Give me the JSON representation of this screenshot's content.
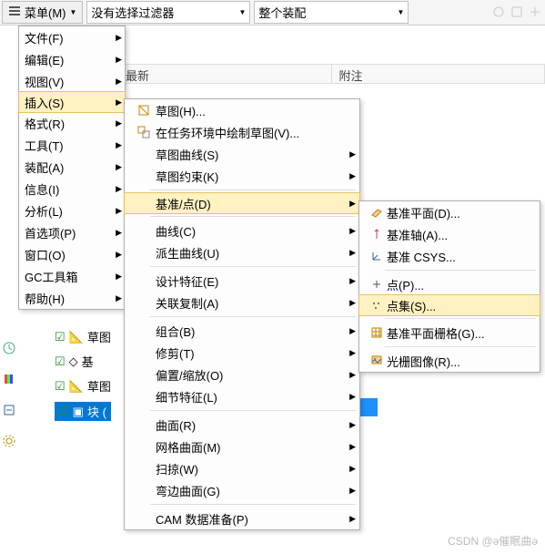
{
  "toolbar": {
    "menu_label": "菜单(M)",
    "filter_value": "没有选择过滤器",
    "assembly_value": "整个装配"
  },
  "headers": {
    "latest": "最新",
    "notes": "附注"
  },
  "menu1": {
    "items": [
      {
        "label": "文件(F)"
      },
      {
        "label": "编辑(E)"
      },
      {
        "label": "视图(V)"
      },
      {
        "label": "插入(S)",
        "hl": true
      },
      {
        "label": "格式(R)"
      },
      {
        "label": "工具(T)"
      },
      {
        "label": "装配(A)"
      },
      {
        "label": "信息(I)"
      },
      {
        "label": "分析(L)"
      },
      {
        "label": "首选项(P)"
      },
      {
        "label": "窗口(O)"
      },
      {
        "label": "GC工具箱"
      },
      {
        "label": "帮助(H)"
      }
    ]
  },
  "menu2": {
    "groups": [
      [
        {
          "label": "草图(H)...",
          "icon": "sketch"
        },
        {
          "label": "在任务环境中绘制草图(V)...",
          "icon": "sketch-task"
        },
        {
          "label": "草图曲线(S)",
          "sub": true
        },
        {
          "label": "草图约束(K)",
          "sub": true
        }
      ],
      [
        {
          "label": "基准/点(D)",
          "sub": true,
          "hl": true
        }
      ],
      [
        {
          "label": "曲线(C)",
          "sub": true
        },
        {
          "label": "派生曲线(U)",
          "sub": true
        }
      ],
      [
        {
          "label": "设计特征(E)",
          "sub": true
        },
        {
          "label": "关联复制(A)",
          "sub": true
        }
      ],
      [
        {
          "label": "组合(B)",
          "sub": true
        },
        {
          "label": "修剪(T)",
          "sub": true
        },
        {
          "label": "偏置/缩放(O)",
          "sub": true
        },
        {
          "label": "细节特征(L)",
          "sub": true
        }
      ],
      [
        {
          "label": "曲面(R)",
          "sub": true
        },
        {
          "label": "网格曲面(M)",
          "sub": true
        },
        {
          "label": "扫掠(W)",
          "sub": true
        },
        {
          "label": "弯边曲面(G)",
          "sub": true
        }
      ],
      [
        {
          "label": "CAM 数据准备(P)",
          "sub": true
        }
      ]
    ]
  },
  "menu3": {
    "items": [
      {
        "label": "基准平面(D)...",
        "icon": "plane"
      },
      {
        "label": "基准轴(A)...",
        "icon": "axis"
      },
      {
        "label": "基准 CSYS...",
        "icon": "csys"
      },
      {
        "sep": true
      },
      {
        "label": "点(P)...",
        "icon": "point"
      },
      {
        "label": "点集(S)...",
        "icon": "pointset",
        "hl": true
      },
      {
        "sep": true
      },
      {
        "label": "基准平面栅格(G)...",
        "icon": "grid"
      },
      {
        "sep": true
      },
      {
        "label": "光栅图像(R)...",
        "icon": "raster"
      }
    ]
  },
  "tree": {
    "items": [
      {
        "label": "草图"
      },
      {
        "label": "基"
      },
      {
        "label": "草图"
      },
      {
        "label": "块 (",
        "sel": true
      }
    ]
  },
  "watermark": "CSDN @ə催眠曲ə"
}
